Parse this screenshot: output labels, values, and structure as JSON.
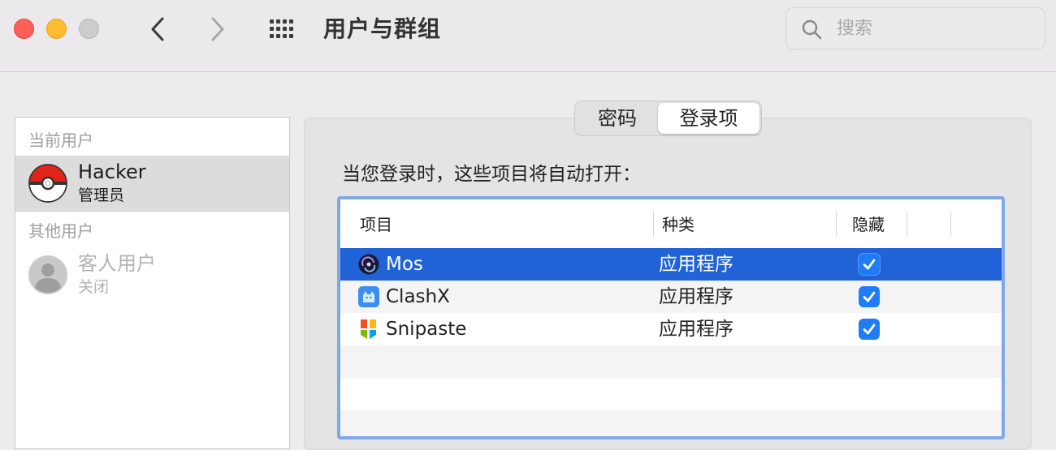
{
  "window": {
    "title": "用户与群组",
    "search_placeholder": "搜索"
  },
  "sidebar": {
    "current_header": "当前用户",
    "current_user": {
      "name": "Hacker",
      "role": "管理员"
    },
    "other_header": "其他用户",
    "guest_user": {
      "name": "客人用户",
      "status": "关闭"
    }
  },
  "tabs": [
    {
      "label": "密码",
      "selected": false
    },
    {
      "label": "登录项",
      "selected": true
    }
  ],
  "login_items": {
    "description": "当您登录时，这些项目将自动打开：",
    "columns": {
      "item": "项目",
      "kind": "种类",
      "hide": "隐藏"
    },
    "rows": [
      {
        "name": "Mos",
        "kind": "应用程序",
        "hidden": true,
        "selected": true,
        "icon": "mos-icon"
      },
      {
        "name": "ClashX",
        "kind": "应用程序",
        "hidden": true,
        "selected": false,
        "icon": "clashx-icon"
      },
      {
        "name": "Snipaste",
        "kind": "应用程序",
        "hidden": true,
        "selected": false,
        "icon": "snipaste-icon"
      }
    ]
  },
  "colors": {
    "selection": "#2163d6",
    "checkbox": "#1f7cf6",
    "focus_ring": "#7fa9e6"
  }
}
